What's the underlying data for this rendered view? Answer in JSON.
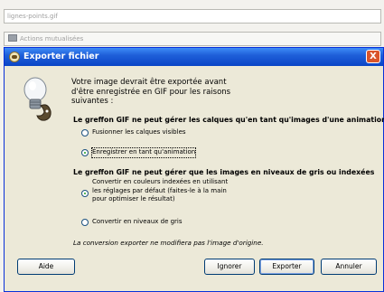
{
  "background": {
    "file_field": "lignes-points.gif",
    "folder_label": "Actions mutualisées"
  },
  "dialog": {
    "title": "Exporter fichier",
    "close_glyph": "X",
    "message_lines": [
      "Votre image devrait être exportée avant",
      "d'être enregistrée en GIF pour les raisons",
      "suivantes :"
    ],
    "section1": {
      "heading": "Le greffon GIF ne peut gérer les calques qu'en tant qu'images d'une animation",
      "options": [
        {
          "label": "Fusionner les calques visibles",
          "selected": false
        },
        {
          "label": "Enregistrer en tant qu'animation",
          "selected": true
        }
      ]
    },
    "section2": {
      "heading": "Le greffon GIF ne peut gérer que les images en niveaux de gris ou indexées",
      "options": [
        {
          "lines": [
            "Convertir en couleurs indexées en utilisant",
            "les réglages par défaut (faites-le à la main",
            "pour optimiser le résultat)"
          ],
          "selected": true
        },
        {
          "lines": [
            "Convertir en niveaux de gris"
          ],
          "selected": false
        }
      ]
    },
    "note": "La conversion exporter ne modifiera pas l'image d'origine.",
    "buttons": {
      "help": "Aide",
      "ignore": "Ignorer",
      "export": "Exporter",
      "cancel": "Annuler"
    }
  },
  "colors": {
    "titlebar": "#1f5fd9",
    "dialog_bg": "#ece9d8",
    "close_button": "#d9542a",
    "radio_dot": "#21a121"
  }
}
